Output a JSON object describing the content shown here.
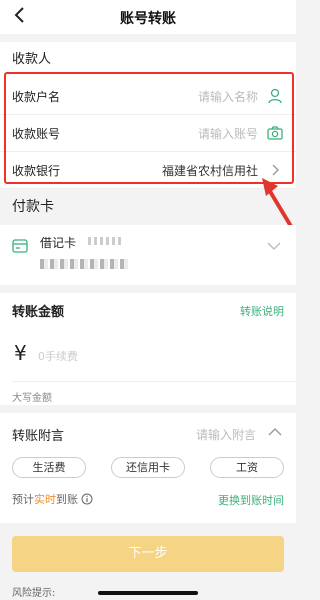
{
  "nav": {
    "title": "账号转账"
  },
  "payee": {
    "section_title": "收款人",
    "name_label": "收款户名",
    "name_placeholder": "请输入名称",
    "account_label": "收款账号",
    "account_placeholder": "请输入账号",
    "bank_label": "收款银行",
    "bank_value": "福建省农村信用社"
  },
  "payer": {
    "section_title": "付款卡",
    "card_name": "借记卡"
  },
  "amount": {
    "title": "转账金额",
    "help_link": "转账说明",
    "currency": "¥",
    "placeholder": "0手续费",
    "uppercase_label": "大写金额"
  },
  "memo": {
    "title": "转账附言",
    "placeholder": "请输入附言",
    "chips": [
      "生活费",
      "还信用卡",
      "工资"
    ],
    "eta_prefix": "预计",
    "eta_highlight": "实时",
    "eta_suffix": "到账",
    "change_link": "更换到账时间"
  },
  "next_button": "下一步",
  "risk_label": "风险提示:",
  "colors": {
    "accent": "#3ab07a",
    "highlight_box": "#f0312a",
    "button": "#f5d585"
  }
}
